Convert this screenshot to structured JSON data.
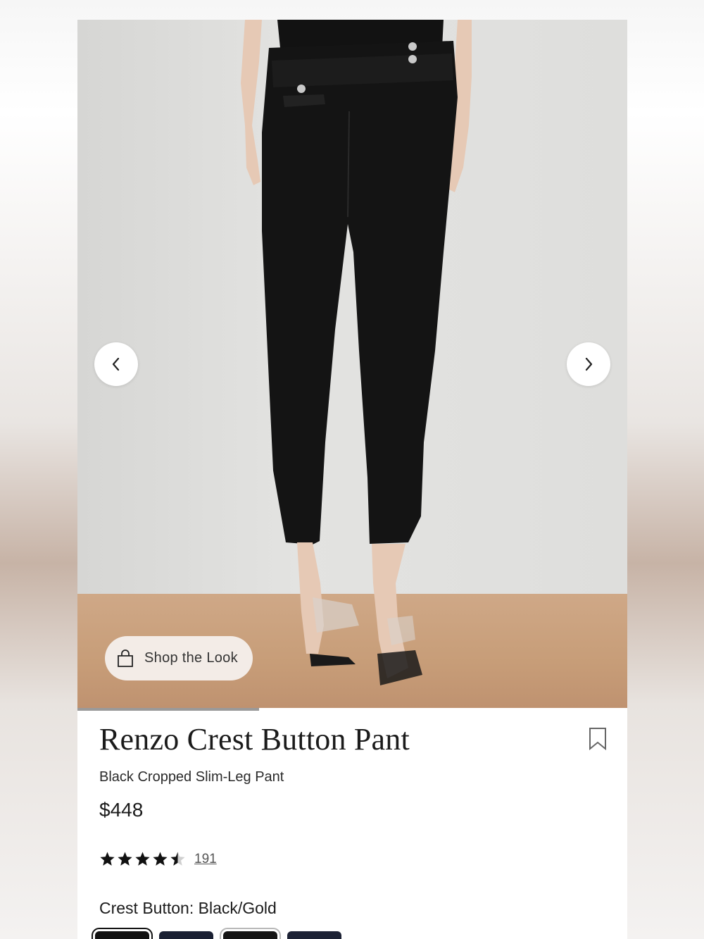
{
  "gallery": {
    "prev_icon": "chevron-left-icon",
    "next_icon": "chevron-right-icon",
    "shop_the_look": "Shop the Look",
    "shop_icon": "shopping-bag-icon",
    "progress": 0.33
  },
  "product": {
    "name": "Renzo Crest Button Pant",
    "description": "Black Cropped Slim-Leg Pant",
    "price": "$448",
    "rating_value": 4.5,
    "rating_max": 5,
    "review_count": "191",
    "bookmark_icon": "bookmark-icon"
  },
  "color": {
    "label": "Crest Button: Black/Gold",
    "swatches": [
      {
        "color": "#111111",
        "selected": true
      },
      {
        "color": "#1a2033",
        "selected": false
      },
      {
        "color": "#151515",
        "selected": false
      },
      {
        "color": "#1d2235",
        "selected": false
      }
    ]
  }
}
